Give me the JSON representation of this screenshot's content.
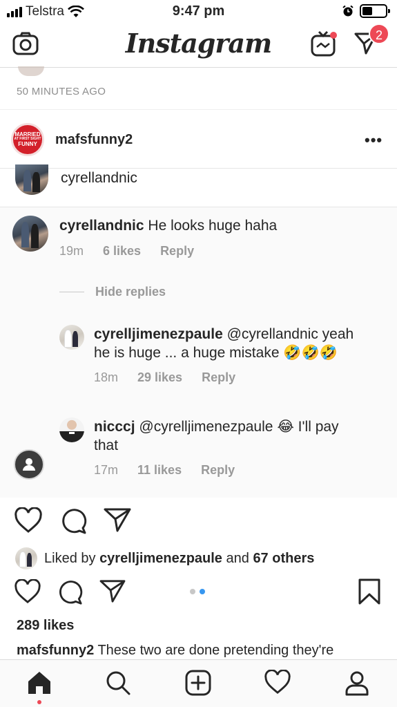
{
  "status_bar": {
    "carrier": "Telstra",
    "time": "9:47 pm"
  },
  "header": {
    "logo": "Instagram",
    "dm_badge_count": "2"
  },
  "previous_post": {
    "timestamp": "50 MINUTES AGO"
  },
  "post": {
    "username": "mafsfunny2",
    "avatar_lines": [
      "MARRIED",
      "AT FIRST SIGHT",
      "FUNNY"
    ],
    "more": "•••",
    "embedded": {
      "top_username": "cyrellandnic",
      "comment": {
        "username": "cyrellandnic",
        "text": "He looks huge haha",
        "time": "19m",
        "likes": "6 likes",
        "reply": "Reply"
      },
      "hide_replies": "Hide replies",
      "replies": [
        {
          "username": "cyrelljimenezpaule",
          "mention": "@cyrellandnic",
          "text_line1_end": "yeah",
          "text_line2": "he is huge ... a huge mistake 🤣🤣🤣",
          "time": "18m",
          "likes": "29 likes",
          "reply": "Reply"
        },
        {
          "username": "nicccj",
          "mention": "@cyrelljimenezpaule",
          "text_line1_end": "😂 I'll pay",
          "text_line2": "that",
          "time": "17m",
          "likes": "11 likes",
          "reply": "Reply"
        }
      ]
    },
    "liked_by": {
      "prefix": "Liked by",
      "user": "cyrelljimenezpaule",
      "and": "and",
      "others": "67 others"
    },
    "likes": "289 likes",
    "caption_user": "mafsfunny2",
    "caption_text": "These two are done pretending they're"
  },
  "colors": {
    "badge": "#ed4956",
    "link_blue": "#3897f0",
    "muted": "#999999"
  },
  "icons": {
    "header": [
      "camera-icon",
      "igtv-icon",
      "direct-icon"
    ],
    "tabbar": [
      "home-icon",
      "search-icon",
      "add-icon",
      "heart-icon",
      "profile-icon"
    ]
  }
}
